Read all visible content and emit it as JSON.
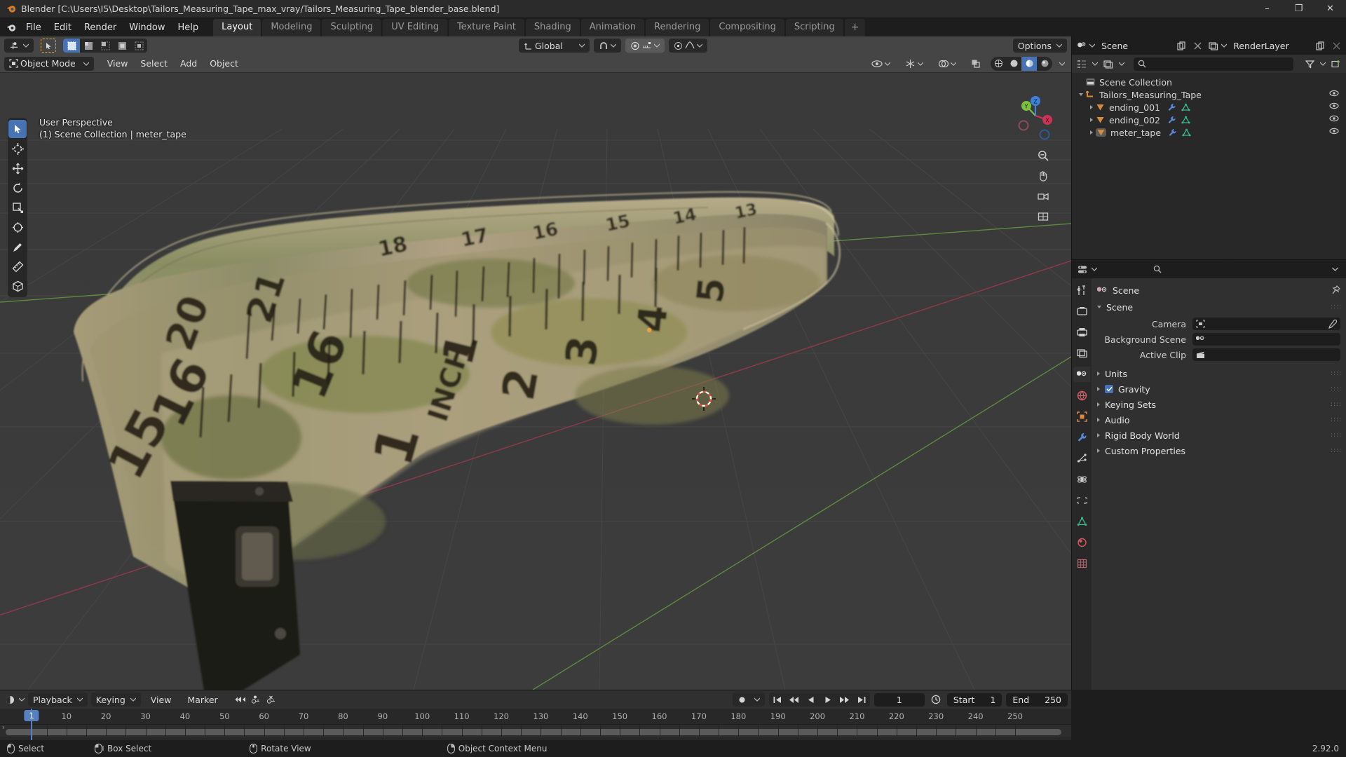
{
  "window": {
    "title": "Blender [C:\\Users\\I5\\Desktop\\Tailors_Measuring_Tape_max_vray/Tailors_Measuring_Tape_blender_base.blend]",
    "minimize": "–",
    "maximize": "❐",
    "close": "✕"
  },
  "menus": [
    "File",
    "Edit",
    "Render",
    "Window",
    "Help"
  ],
  "workspace_tabs": [
    {
      "label": "Layout",
      "active": true
    },
    {
      "label": "Modeling",
      "active": false
    },
    {
      "label": "Sculpting",
      "active": false
    },
    {
      "label": "UV Editing",
      "active": false
    },
    {
      "label": "Texture Paint",
      "active": false
    },
    {
      "label": "Shading",
      "active": false
    },
    {
      "label": "Animation",
      "active": false
    },
    {
      "label": "Rendering",
      "active": false
    },
    {
      "label": "Compositing",
      "active": false
    },
    {
      "label": "Scripting",
      "active": false
    },
    {
      "label": "+",
      "active": false
    }
  ],
  "viewport": {
    "mode": "Object Mode",
    "menus": [
      "View",
      "Select",
      "Add",
      "Object"
    ],
    "transform_orientation": "Global",
    "options_label": "Options",
    "overlay_line1": "User Perspective",
    "overlay_line2": "(1) Scene Collection | meter_tape",
    "gizmo_axes": {
      "x": "X",
      "y": "Y",
      "z": "Z"
    },
    "tools": [
      {
        "name": "tweak-tool",
        "active": true
      },
      {
        "name": "cursor-tool",
        "active": false
      },
      {
        "name": "move-tool",
        "active": false
      },
      {
        "name": "rotate-tool",
        "active": false
      },
      {
        "name": "scale-tool",
        "active": false
      },
      {
        "name": "transform-tool",
        "active": false
      },
      {
        "name": "annotate-tool",
        "active": false
      },
      {
        "name": "measure-tool",
        "active": false
      },
      {
        "name": "add-cube-tool",
        "active": false
      }
    ]
  },
  "outliner": {
    "scene_name": "Scene",
    "view_layer_name": "RenderLayer",
    "search_placeholder": "",
    "rows": [
      {
        "label": "Scene Collection",
        "indent": 0,
        "icon": "collection-icon",
        "expander": "none",
        "eye": false,
        "selected": false
      },
      {
        "label": "Tailors_Measuring_Tape",
        "indent": 1,
        "icon": "empty-axis-icon",
        "expander": "open",
        "eye": true,
        "selected": false
      },
      {
        "label": "ending_001",
        "indent": 2,
        "icon": "mesh-icon",
        "expander": "closed",
        "eye": true,
        "selected": false
      },
      {
        "label": "ending_002",
        "indent": 2,
        "icon": "mesh-icon",
        "expander": "closed",
        "eye": true,
        "selected": false
      },
      {
        "label": "meter_tape",
        "indent": 2,
        "icon": "mesh-icon",
        "expander": "closed",
        "eye": true,
        "selected": true
      }
    ]
  },
  "properties": {
    "search_placeholder": "",
    "breadcrumb": "Scene",
    "panel_title": "Scene",
    "fields": [
      {
        "label": "Camera",
        "value": "",
        "icon": "camera-icon",
        "eyedropper": true
      },
      {
        "label": "Background Scene",
        "value": "",
        "icon": "scene-icon",
        "eyedropper": false
      },
      {
        "label": "Active Clip",
        "value": "",
        "icon": "clip-icon",
        "eyedropper": false
      }
    ],
    "panels": [
      {
        "label": "Units",
        "checkbox": null
      },
      {
        "label": "Gravity",
        "checkbox": true
      },
      {
        "label": "Keying Sets",
        "checkbox": null
      },
      {
        "label": "Audio",
        "checkbox": null
      },
      {
        "label": "Rigid Body World",
        "checkbox": null
      },
      {
        "label": "Custom Properties",
        "checkbox": null
      }
    ],
    "tabs": [
      {
        "name": "tool-tab",
        "active": false
      },
      {
        "name": "render-tab",
        "active": false
      },
      {
        "name": "output-tab",
        "active": false
      },
      {
        "name": "view-layer-tab",
        "active": false
      },
      {
        "name": "scene-tab",
        "active": true
      },
      {
        "name": "world-tab",
        "active": false
      },
      {
        "name": "object-tab",
        "active": false
      },
      {
        "name": "modifier-tab",
        "active": false
      },
      {
        "name": "particles-tab",
        "active": false
      },
      {
        "name": "physics-tab",
        "active": false
      },
      {
        "name": "constraints-tab",
        "active": false
      },
      {
        "name": "data-tab",
        "active": false
      },
      {
        "name": "material-tab",
        "active": false
      },
      {
        "name": "texture-tab",
        "active": false
      }
    ]
  },
  "timeline": {
    "menus": [
      "Playback",
      "Keying",
      "View",
      "Marker"
    ],
    "current_frame": "1",
    "start_label": "Start",
    "start_value": "1",
    "end_label": "End",
    "end_value": "250",
    "ticks": [
      "1",
      "10",
      "20",
      "30",
      "40",
      "50",
      "60",
      "70",
      "80",
      "90",
      "100",
      "110",
      "120",
      "130",
      "140",
      "150",
      "160",
      "170",
      "180",
      "190",
      "200",
      "210",
      "220",
      "230",
      "240",
      "250"
    ],
    "playhead_frame": "1"
  },
  "statusbar": {
    "items": [
      {
        "mouse": "left",
        "label": "Select"
      },
      {
        "mouse": "left-drag",
        "label": "Box Select"
      },
      {
        "mouse": "middle",
        "label": "Rotate View"
      },
      {
        "mouse": "right",
        "label": "Object Context Menu"
      }
    ],
    "version": "2.92.0"
  },
  "colors": {
    "accent": "#4772b3",
    "header": "#454545",
    "panel": "#303030",
    "dark": "#1d1d1d",
    "axis_x": "#cc3355",
    "axis_y": "#7cbf3f",
    "axis_z": "#3d82d8",
    "mesh_icon": "#e08a3c",
    "modifier_icon": "#5a88d6",
    "data_icon": "#37b88a"
  }
}
